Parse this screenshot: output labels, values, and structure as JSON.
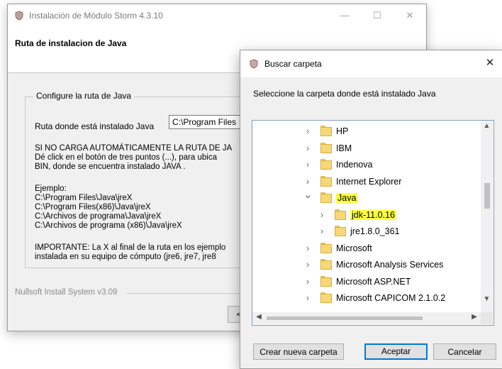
{
  "installer": {
    "title": "Instalación de Módulo Storm 4.3.10",
    "heading": "Ruta de instalacion de Java",
    "group_label": "Configure la ruta de Java",
    "path_label": "Ruta donde está instalado Java",
    "path_value": "C:\\Program Files",
    "lines": [
      "SI NO CARGA AUTOMÁTICAMENTE LA RUTA DE JA",
      "Dé click en el botón de tres puntos (...), para ubica",
      "BIN, donde se encuentra instalado JAVA ."
    ],
    "example_label": "Ejemplo:",
    "examples": [
      "C:\\Program Files\\Java\\jreX",
      "C:\\Program Files(x86)\\Java\\jreX",
      "C:\\Archivos de programa\\Java\\jreX",
      "C:\\Archivos de programa (x86)\\Java\\jreX"
    ],
    "important_lines": [
      "IMPORTANTE: La X al final de la ruta en los ejemplo",
      "instalada en su equipo de cómputo (jre6, jre7, jre8"
    ],
    "footer": "Nullsoft Install System v3.09",
    "back_button": "<",
    "minimize": "—",
    "maximize": "☐",
    "close": "✕"
  },
  "dialog": {
    "title": "Buscar carpeta",
    "close": "✕",
    "instruction": "Seleccione la carpeta donde está instalado Java",
    "tree": [
      {
        "label": "HP",
        "expanded": false
      },
      {
        "label": "IBM",
        "expanded": false
      },
      {
        "label": "Indenova",
        "expanded": false
      },
      {
        "label": "Internet Explorer",
        "expanded": false
      },
      {
        "label": "Java",
        "expanded": true,
        "highlight": true
      },
      {
        "label": "jdk-11.0.16",
        "child": true,
        "highlight": true
      },
      {
        "label": "jre1.8.0_361",
        "child": true
      },
      {
        "label": "Microsoft",
        "expanded": false
      },
      {
        "label": "Microsoft Analysis Services",
        "expanded": false
      },
      {
        "label": "Microsoft ASP.NET",
        "expanded": false
      },
      {
        "label": "Microsoft CAPICOM 2.1.0.2",
        "expanded": false
      }
    ],
    "new_folder_button": "Crear nueva carpeta",
    "accept_button": "Aceptar",
    "cancel_button": "Cancelar"
  },
  "colors": {
    "highlight": "#ffff3b",
    "folder": "#f8d775",
    "accent": "#0078d7"
  }
}
